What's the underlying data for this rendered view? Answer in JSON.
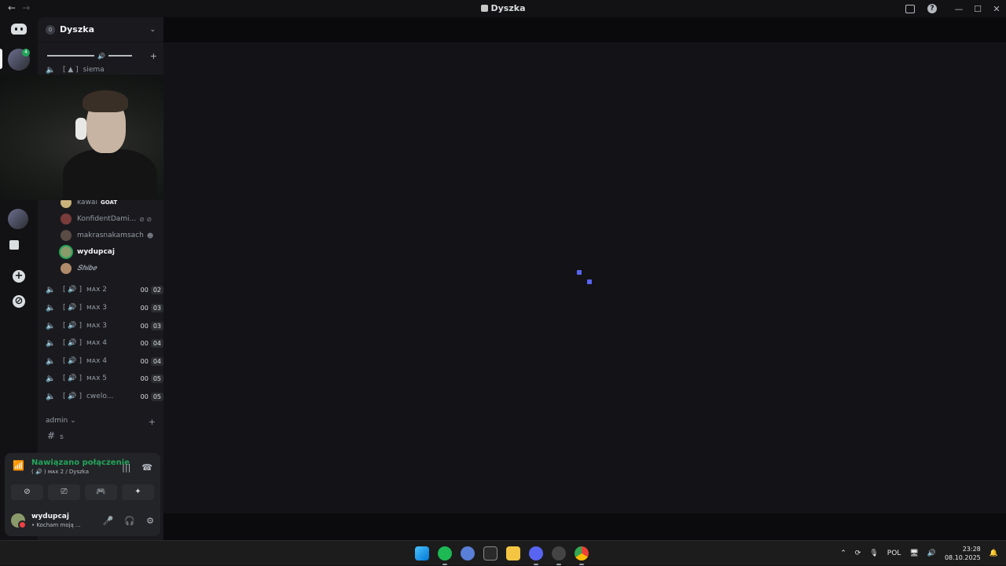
{
  "window": {
    "title": "Dyszka",
    "nav_back": "←",
    "nav_forward": "→"
  },
  "server": {
    "name": "Dyszka"
  },
  "channels": {
    "top_channel": "siema",
    "voice_users": [
      {
        "name": "kawai",
        "tag": "GOAT"
      },
      {
        "name": "KonfidentDami..."
      },
      {
        "name": "makrasnakamsach"
      },
      {
        "name": "wydupcaj"
      },
      {
        "name": "𝑺𝒉𝒊𝒃𝒆"
      }
    ],
    "voice_channels": [
      {
        "name": "ᴍᴀx 2",
        "count": "00",
        "limit": "02"
      },
      {
        "name": "ᴍᴀx 3",
        "count": "00",
        "limit": "03"
      },
      {
        "name": "ᴍᴀx 3",
        "count": "00",
        "limit": "03"
      },
      {
        "name": "ᴍᴀx 4",
        "count": "00",
        "limit": "04"
      },
      {
        "name": "ᴍᴀx 4",
        "count": "00",
        "limit": "04"
      },
      {
        "name": "ᴍᴀx 5",
        "count": "00",
        "limit": "05"
      },
      {
        "name": "cwelo...",
        "count": "00",
        "limit": "05"
      }
    ],
    "category": "admin",
    "text_channel": "s"
  },
  "voice_panel": {
    "status": "Nawiązano połączenie",
    "location": "ᴍᴀx 2 / Dyszka"
  },
  "user_panel": {
    "username": "wydupcaj",
    "status": "• Kocham moją ..."
  },
  "taskbar": {
    "language": "POL",
    "time": "23:28",
    "date": "08.10.2025"
  },
  "colors": {
    "accent": "#5865f2",
    "connected": "#23a55a",
    "dnd": "#f23f43"
  }
}
